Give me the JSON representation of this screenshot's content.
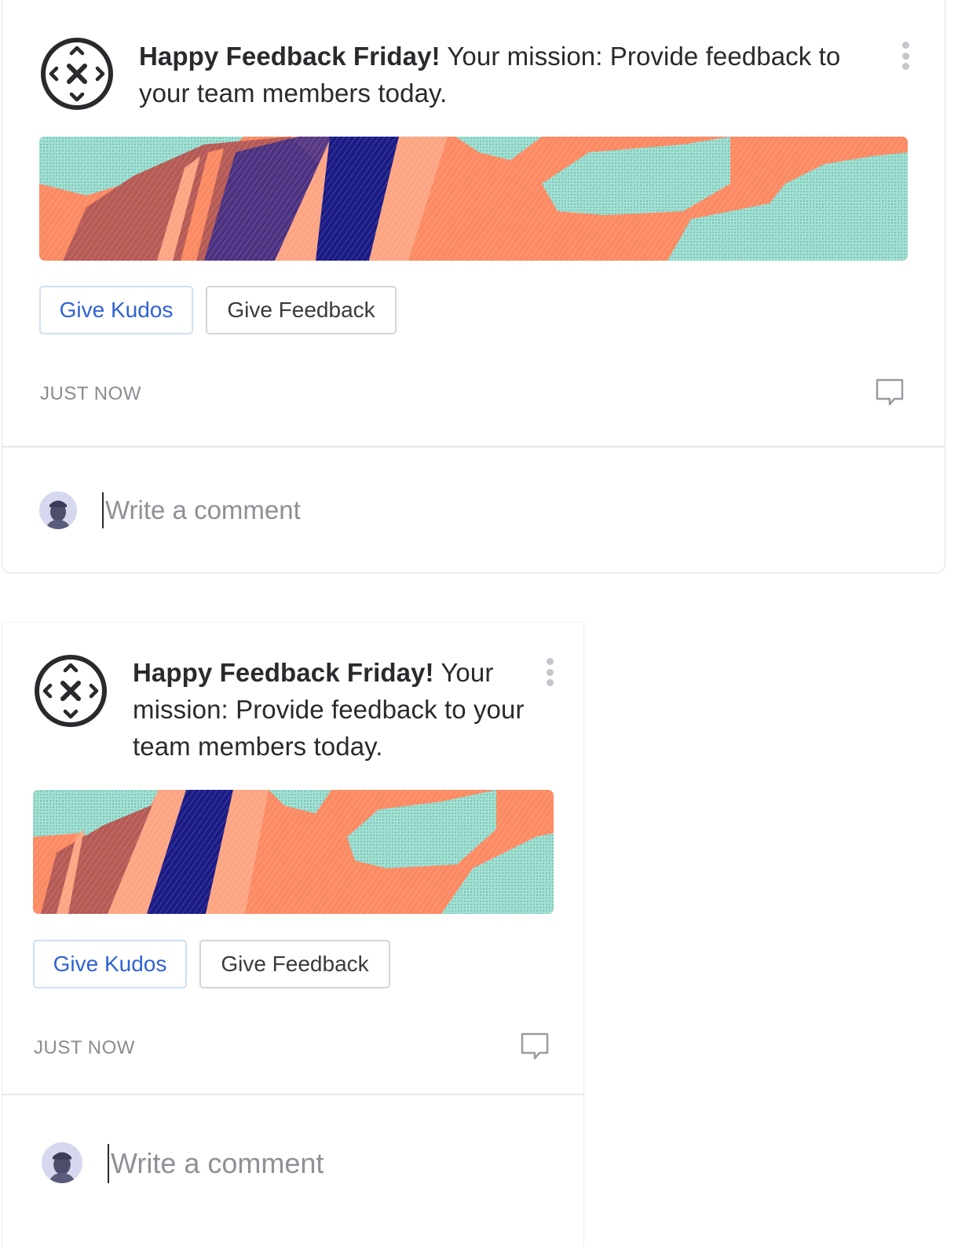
{
  "cards": [
    {
      "message_bold": "Happy Feedback Friday!",
      "message_rest": " Your mission: Provide feedback to your team members today.",
      "buttons": {
        "kudos_label": "Give Kudos",
        "feedback_label": "Give Feedback"
      },
      "timestamp": "JUST NOW",
      "comment_placeholder": "Write a comment",
      "comment_value": ""
    },
    {
      "message_bold": "Happy Feedback Friday!",
      "message_rest": " Your mission: Provide feedback to your team members today.",
      "buttons": {
        "kudos_label": "Give Kudos",
        "feedback_label": "Give Feedback"
      },
      "timestamp": "JUST NOW",
      "comment_placeholder": "Write a comment",
      "comment_value": ""
    }
  ],
  "icons": {
    "logo": "compass-arrows-logo-icon",
    "menu": "more-vertical-icon",
    "comment": "comment-bubble-icon",
    "avatar": "user-avatar"
  },
  "colors": {
    "kudos_text": "#2f62d6",
    "kudos_border": "#cfe0f7",
    "banner_orange": "#fb8a63",
    "banner_teal": "#9ee0d2",
    "banner_navy": "#1b1b86",
    "banner_peach": "#fda583"
  }
}
